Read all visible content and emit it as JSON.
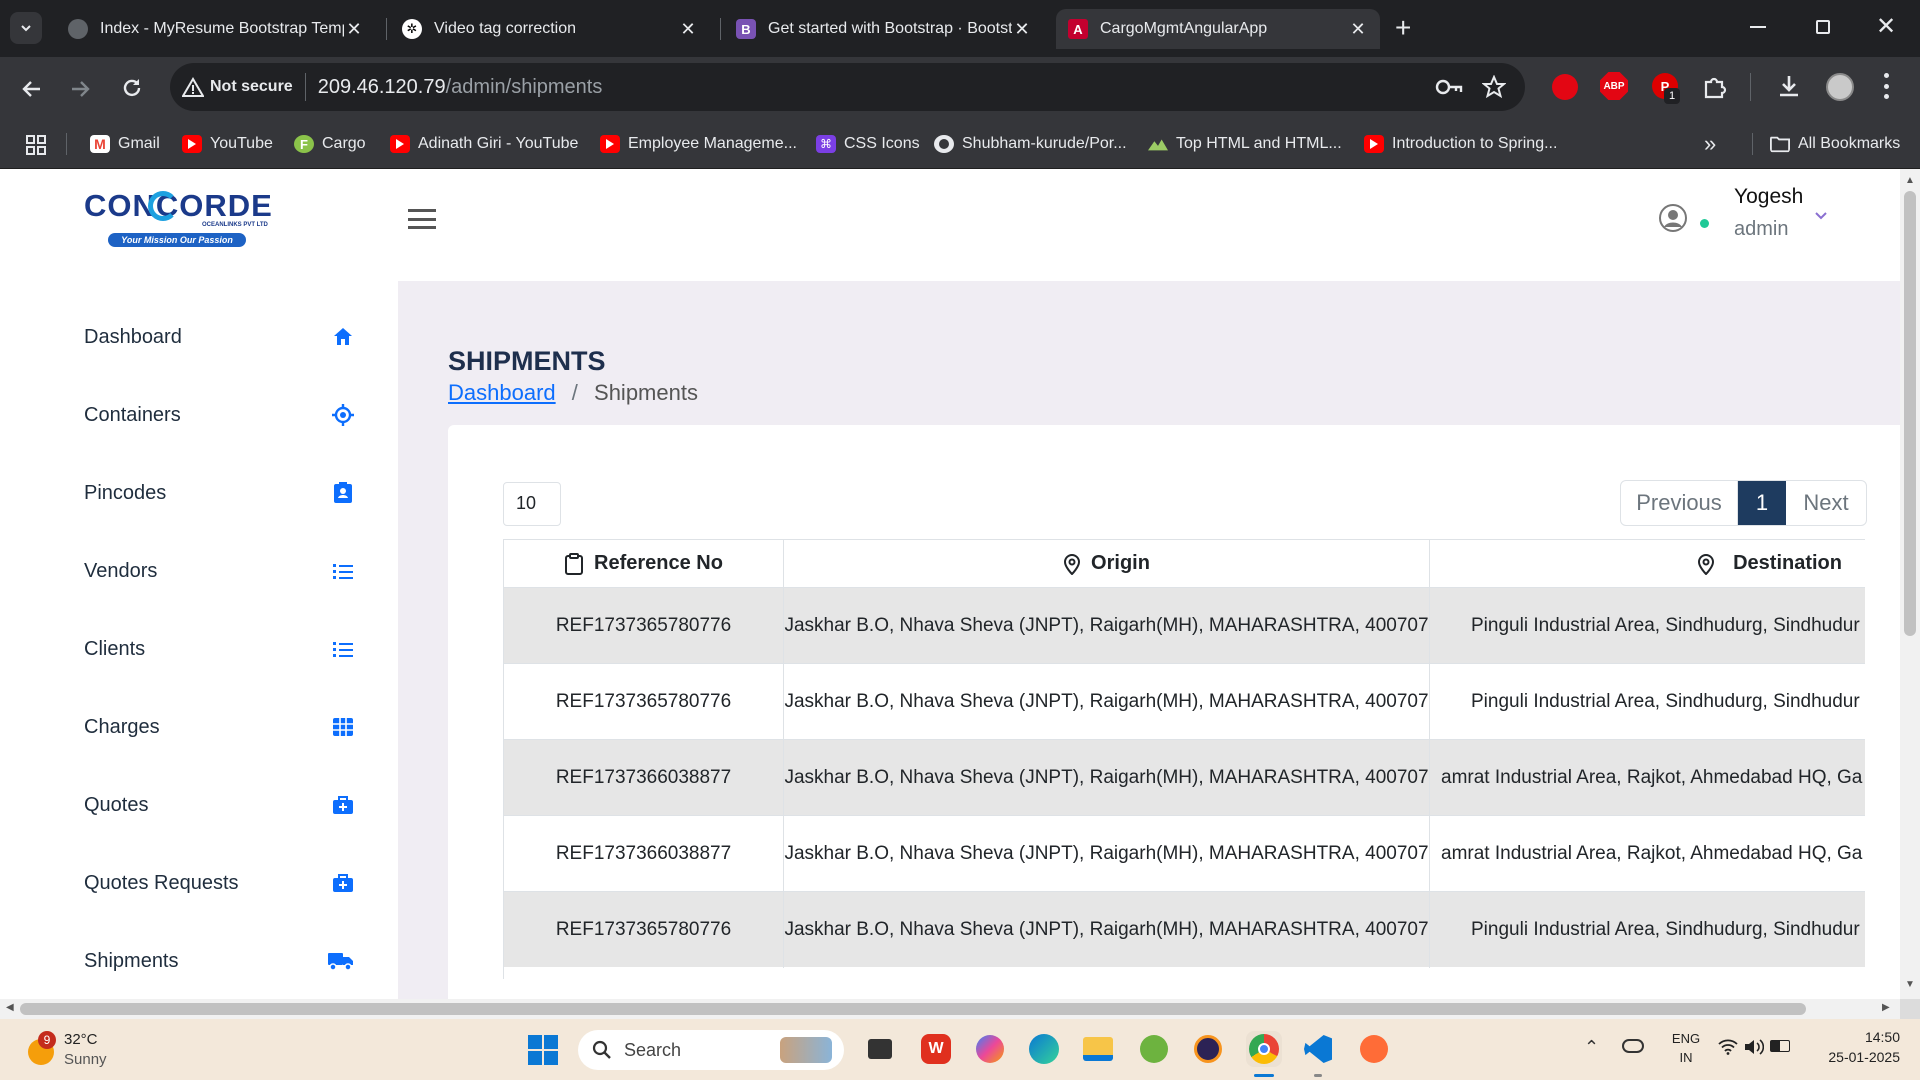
{
  "browser": {
    "tabs": [
      {
        "title": "Index - MyResume Bootstrap Temp"
      },
      {
        "title": "Video tag correction"
      },
      {
        "title": "Get started with Bootstrap · Bootst"
      },
      {
        "title": "CargoMgmtAngularApp"
      }
    ],
    "security_label": "Not secure",
    "url_host": "209.46.120.79",
    "url_path": "/admin/shipments",
    "bookmarks": [
      {
        "label": "Gmail",
        "icon": "gmail-icon"
      },
      {
        "label": "YouTube",
        "icon": "youtube-icon"
      },
      {
        "label": "Cargo",
        "icon": "cargo-icon"
      },
      {
        "label": "Adinath Giri - YouTube",
        "icon": "youtube-icon"
      },
      {
        "label": "Employee Manageme...",
        "icon": "youtube-icon"
      },
      {
        "label": "CSS Icons",
        "icon": "css-icon"
      },
      {
        "label": "Shubham-kurude/Por...",
        "icon": "github-icon"
      },
      {
        "label": "Top HTML and HTML...",
        "icon": "mountain-icon"
      },
      {
        "label": "Introduction to Spring...",
        "icon": "youtube-icon"
      }
    ],
    "all_bookmarks": "All Bookmarks",
    "extensions": {
      "abp": "ABP",
      "badge": "1"
    }
  },
  "app": {
    "logo": {
      "brand": "CONCORDE",
      "sub": "OCEANLINKS PVT LTD",
      "tagline": "Your Mission Our Passion"
    },
    "user": {
      "name": "Yogesh",
      "role": "admin"
    },
    "nav": [
      {
        "label": "Dashboard",
        "icon": "home-icon"
      },
      {
        "label": "Containers",
        "icon": "target-icon"
      },
      {
        "label": "Pincodes",
        "icon": "contact-card-icon"
      },
      {
        "label": "Vendors",
        "icon": "list-icon"
      },
      {
        "label": "Clients",
        "icon": "list-icon"
      },
      {
        "label": "Charges",
        "icon": "grid-icon"
      },
      {
        "label": "Quotes",
        "icon": "briefcase-plus-icon"
      },
      {
        "label": "Quotes Requests",
        "icon": "briefcase-plus-icon"
      },
      {
        "label": "Shipments",
        "icon": "truck-icon"
      }
    ],
    "page_title": "SHIPMENTS",
    "breadcrumb": {
      "home": "Dashboard",
      "sep": "/",
      "current": "Shipments"
    },
    "page_size": "10",
    "pagination": {
      "previous": "Previous",
      "current": "1",
      "next": "Next"
    },
    "table": {
      "columns": [
        "Reference No",
        "Origin",
        "Destination"
      ],
      "rows": [
        {
          "ref": "REF1737365780776",
          "origin": "Jaskhar B.O, Nhava Sheva (JNPT), Raigarh(MH), MAHARASHTRA, 400707",
          "destination": "Pinguli Industrial Area, Sindhudurg, Sindhudur"
        },
        {
          "ref": "REF1737365780776",
          "origin": "Jaskhar B.O, Nhava Sheva (JNPT), Raigarh(MH), MAHARASHTRA, 400707",
          "destination": "Pinguli Industrial Area, Sindhudurg, Sindhudur"
        },
        {
          "ref": "REF1737366038877",
          "origin": "Jaskhar B.O, Nhava Sheva (JNPT), Raigarh(MH), MAHARASHTRA, 400707",
          "destination": "amrat Industrial Area, Rajkot, Ahmedabad HQ, Ga"
        },
        {
          "ref": "REF1737366038877",
          "origin": "Jaskhar B.O, Nhava Sheva (JNPT), Raigarh(MH), MAHARASHTRA, 400707",
          "destination": "amrat Industrial Area, Rajkot, Ahmedabad HQ, Ga"
        },
        {
          "ref": "REF1737365780776",
          "origin": "Jaskhar B.O, Nhava Sheva (JNPT), Raigarh(MH), MAHARASHTRA, 400707",
          "destination": "Pinguli Industrial Area, Sindhudurg, Sindhudur"
        }
      ]
    }
  },
  "taskbar": {
    "weather": {
      "temp": "32°C",
      "cond": "Sunny",
      "badge": "9"
    },
    "search": "Search",
    "lang": "ENG",
    "region": "IN",
    "time": "14:50",
    "date": "25-01-2025"
  },
  "colors": {
    "accent": "#0d6efd",
    "pager_active": "#1e3b5f",
    "main_bg": "#f0edf3",
    "nav_icon": "#0d6efd"
  }
}
